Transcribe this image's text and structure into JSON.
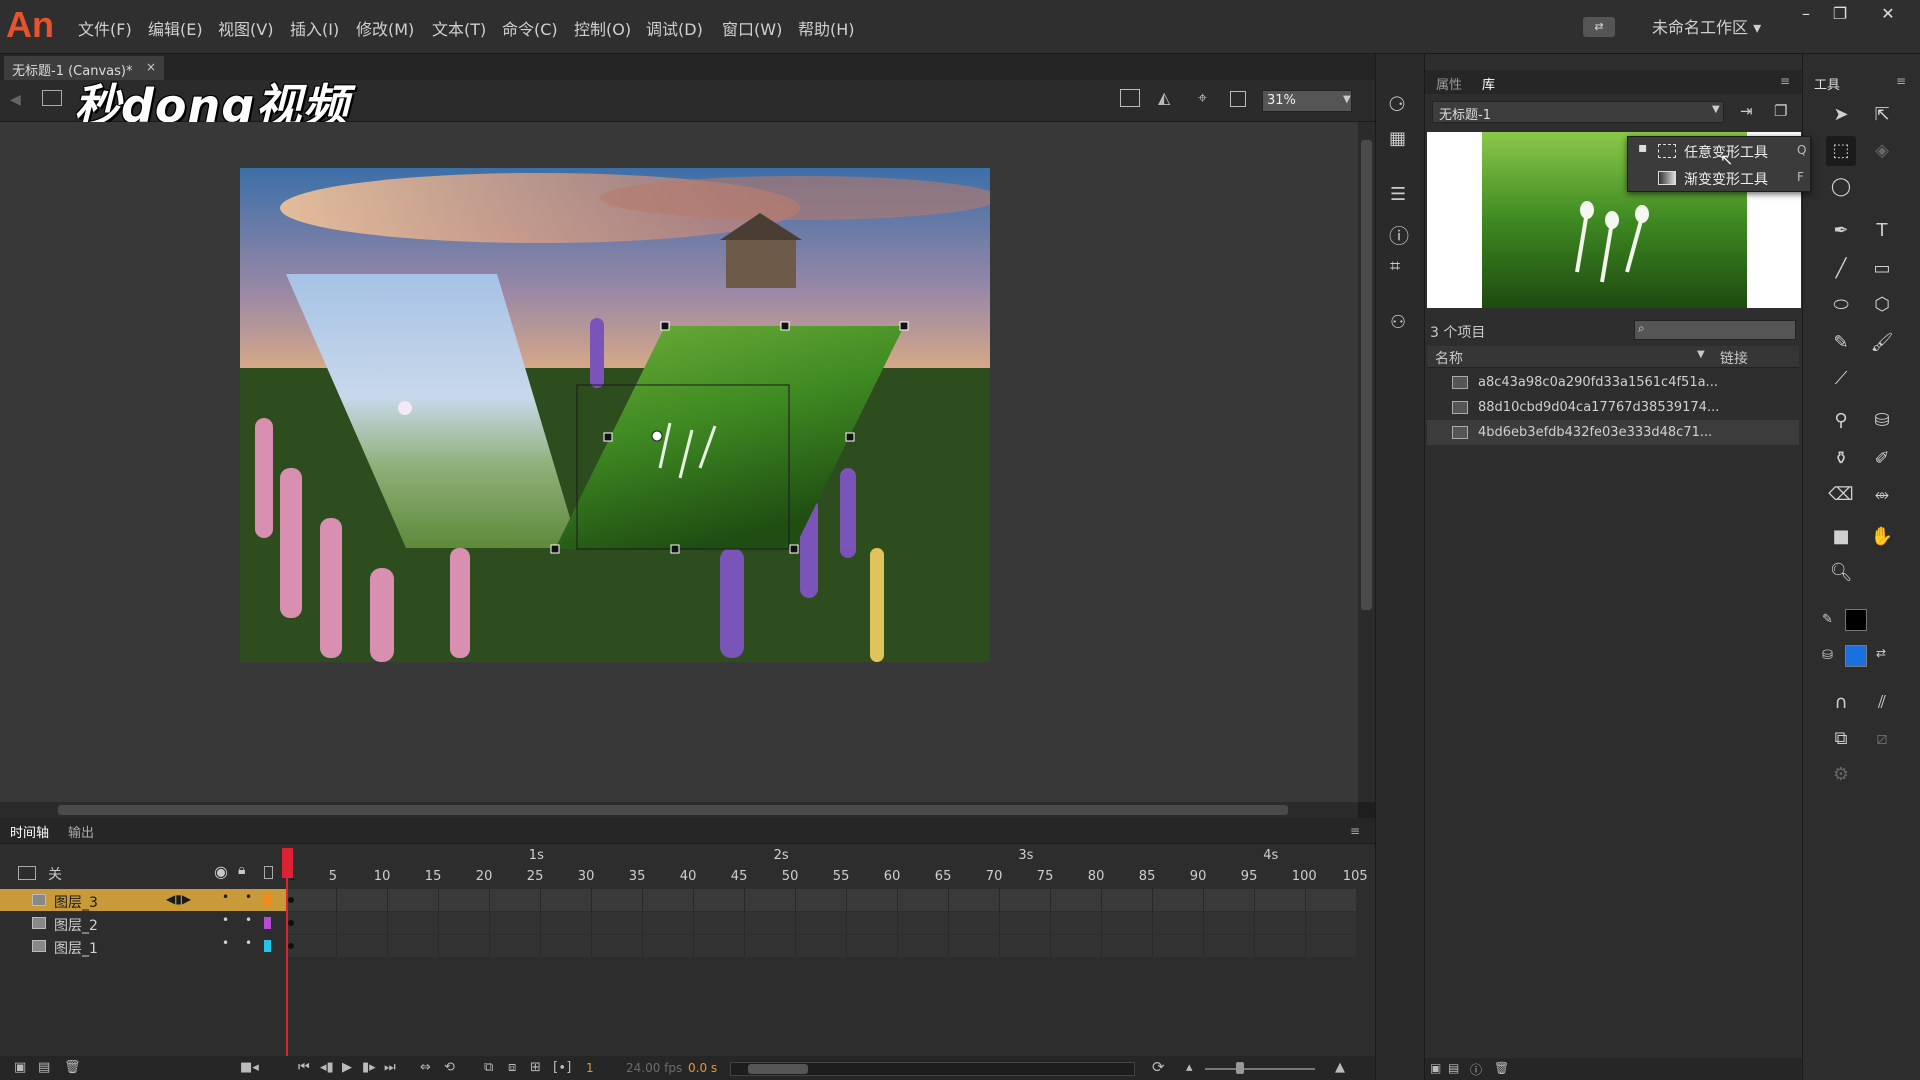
{
  "app": {
    "logo": "An"
  },
  "menu": [
    "文件(F)",
    "编辑(E)",
    "视图(V)",
    "插入(I)",
    "修改(M)",
    "文本(T)",
    "命令(C)",
    "控制(O)",
    "调试(D)",
    "窗口(W)",
    "帮助(H)"
  ],
  "workspace": {
    "label": "未命名工作区 ▾"
  },
  "window_buttons": {
    "minimize": "–",
    "restore": "❐",
    "close": "✕"
  },
  "document": {
    "tab_title": "无标题-1 (Canvas)*",
    "close": "×"
  },
  "watermark": "秒dong视频",
  "editbar": {
    "zoom": "31%"
  },
  "timeline": {
    "tabs": [
      "时间轴",
      "输出"
    ],
    "header_label": "关",
    "layers": [
      {
        "name": "图层_3",
        "color": "#f08c1e",
        "selected": true
      },
      {
        "name": "图层_2",
        "color": "#b84bd6",
        "selected": false
      },
      {
        "name": "图层_1",
        "color": "#21c5e6",
        "selected": false
      }
    ],
    "seconds": [
      "1s",
      "2s",
      "3s",
      "4s"
    ],
    "frame_ticks": [
      "1",
      "5",
      "10",
      "15",
      "20",
      "25",
      "30",
      "35",
      "40",
      "45",
      "50",
      "55",
      "60",
      "65",
      "70",
      "75",
      "80",
      "85",
      "90",
      "95",
      "100",
      "105"
    ],
    "current_frame": "1",
    "fps": "24.00 fps",
    "time": "0.0 s"
  },
  "library": {
    "tabs": [
      "属性",
      "库"
    ],
    "document_select": "无标题-1",
    "item_count": "3 个项目",
    "columns": {
      "name": "名称",
      "link": "链接"
    },
    "items": [
      "a8c43a98c0a290fd33a1561c4f51a...",
      "88d10cbd9d04ca17767d38539174...",
      "4bd6eb3efdb432fe03e333d48c71..."
    ]
  },
  "tools": {
    "title": "工具",
    "flyout": [
      {
        "label": "任意变形工具",
        "shortcut": "Q",
        "selected": true
      },
      {
        "label": "渐变变形工具",
        "shortcut": "F",
        "selected": false
      }
    ],
    "stroke_color": "#000000",
    "fill_color": "#1b6fe0"
  }
}
